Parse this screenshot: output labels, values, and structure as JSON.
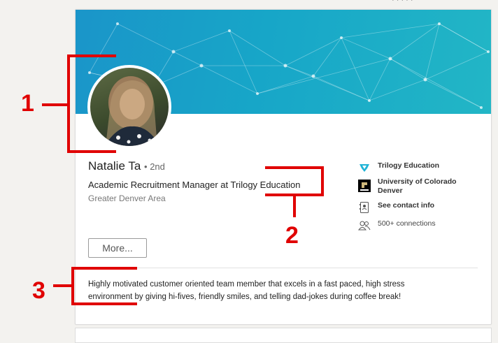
{
  "top_partial_text": "· · · · ·",
  "profile": {
    "name": "Natalie Ta",
    "degree": "• 2nd",
    "headline": "Academic Recruitment Manager at Trilogy Education",
    "location": "Greater Denver Area",
    "more_button": "More...",
    "summary_line1": "Highly motivated customer oriented team member that excels in a fast paced, high stress",
    "summary_line2": "environment by giving hi-fives, friendly smiles, and telling dad-jokes during coffee break!"
  },
  "side": {
    "company": "Trilogy Education",
    "school_line1": "University of Colorado",
    "school_line2": "Denver",
    "contact": "See contact info",
    "connections": "500+ connections"
  },
  "annotations": {
    "n1": "1",
    "n2": "2",
    "n3": "3"
  },
  "colors": {
    "annotation_red": "#e00000",
    "banner_start": "#1a95c9",
    "banner_end": "#22b6c6"
  }
}
